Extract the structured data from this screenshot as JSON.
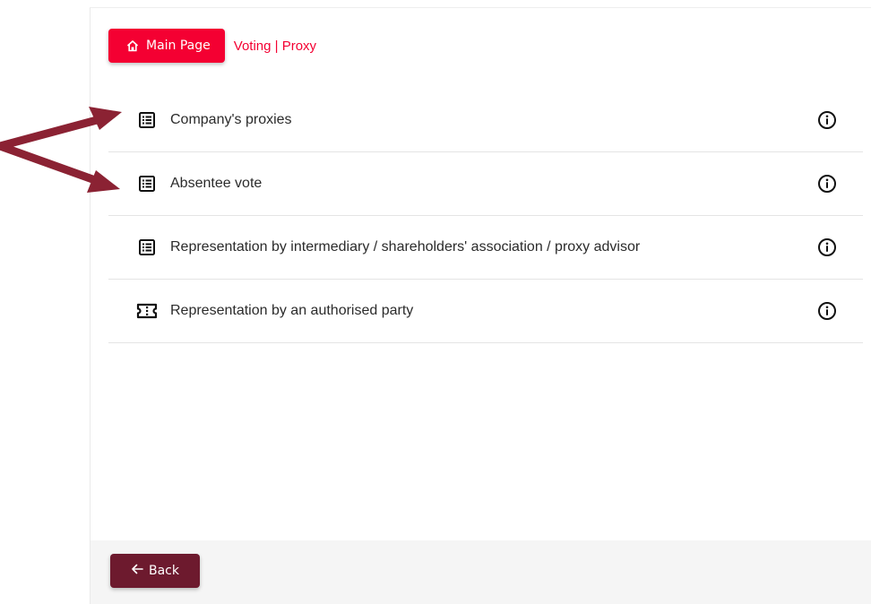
{
  "breadcrumb": {
    "home_label": "Main Page",
    "current": "Voting | Proxy"
  },
  "items": [
    {
      "label": "Company's proxies",
      "icon": "list-icon"
    },
    {
      "label": "Absentee vote",
      "icon": "list-icon"
    },
    {
      "label": "Representation by intermediary / shareholders' association / proxy advisor",
      "icon": "list-icon"
    },
    {
      "label": "Representation by an authorised party",
      "icon": "ticket-icon"
    }
  ],
  "footer": {
    "back_label": "Back"
  },
  "colors": {
    "primary": "#f40032",
    "back_button": "#6d1a2e",
    "annotation_arrow": "#8b2233"
  }
}
